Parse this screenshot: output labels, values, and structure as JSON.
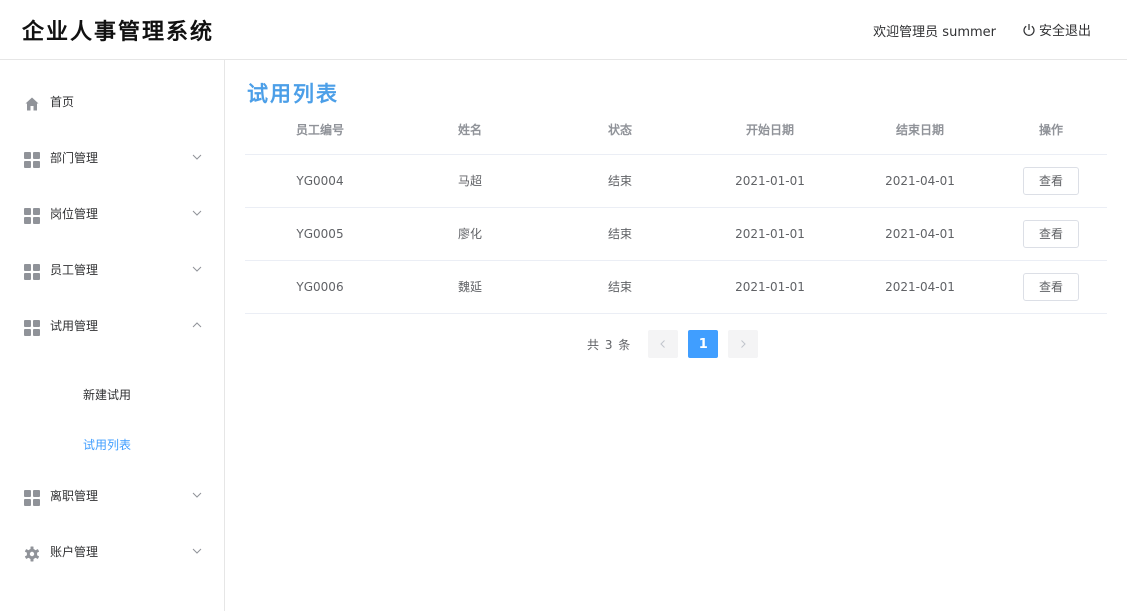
{
  "header": {
    "app_title": "企业人事管理系统",
    "welcome": "欢迎管理员 summer",
    "logout_label": "安全退出"
  },
  "sidebar": {
    "items": [
      {
        "label": "首页",
        "icon": "home-icon"
      },
      {
        "label": "部门管理",
        "icon": "grid-icon",
        "expandable": true
      },
      {
        "label": "岗位管理",
        "icon": "grid-icon",
        "expandable": true
      },
      {
        "label": "员工管理",
        "icon": "grid-icon",
        "expandable": true
      },
      {
        "label": "试用管理",
        "icon": "grid-icon",
        "expandable": true,
        "expanded": true
      },
      {
        "label": "离职管理",
        "icon": "grid-icon",
        "expandable": true
      },
      {
        "label": "账户管理",
        "icon": "gear-icon",
        "expandable": true
      }
    ],
    "sub_items": [
      {
        "label": "新建试用",
        "active": false
      },
      {
        "label": "试用列表",
        "active": true
      }
    ]
  },
  "main": {
    "title": "试用列表",
    "table": {
      "headers": [
        "员工编号",
        "姓名",
        "状态",
        "开始日期",
        "结束日期",
        "操作"
      ],
      "rows": [
        {
          "id": "YG0004",
          "name": "马超",
          "status": "结束",
          "start": "2021-01-01",
          "end": "2021-04-01",
          "action": "查看"
        },
        {
          "id": "YG0005",
          "name": "廖化",
          "status": "结束",
          "start": "2021-01-01",
          "end": "2021-04-01",
          "action": "查看"
        },
        {
          "id": "YG0006",
          "name": "魏延",
          "status": "结束",
          "start": "2021-01-01",
          "end": "2021-04-01",
          "action": "查看"
        }
      ]
    },
    "pagination": {
      "total_text": "共 3 条",
      "current_page": "1"
    }
  },
  "colors": {
    "accent": "#409eff",
    "title_blue": "#4c9fe8",
    "border": "#e6e6e6"
  }
}
